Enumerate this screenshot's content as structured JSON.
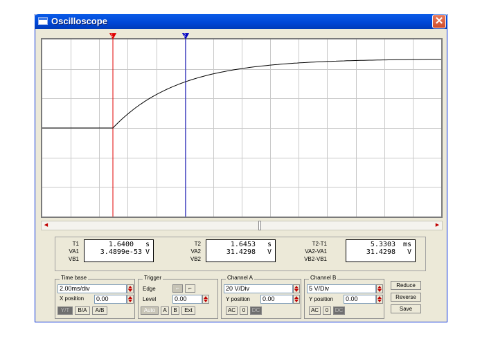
{
  "window": {
    "title": "Oscilloscope",
    "close_glyph": "✕"
  },
  "cursors": [
    {
      "name": "T1",
      "marker_label": "1",
      "color": "#e00000"
    },
    {
      "name": "T2",
      "marker_label": "2",
      "color": "#0000c0"
    }
  ],
  "readouts": {
    "t1": {
      "label_t": "T1",
      "label_va": "VA1",
      "label_vb": "VB1",
      "time_value": "1.6400",
      "time_unit": "s",
      "va_value": "3.4899e-53",
      "va_unit": "V"
    },
    "t2": {
      "label_t": "T2",
      "label_va": "VA2",
      "label_vb": "VB2",
      "time_value": "1.6453",
      "time_unit": "s",
      "va_value": "31.4298",
      "va_unit": "V"
    },
    "diff": {
      "label_t": "T2-T1",
      "label_va": "VA2-VA1",
      "label_vb": "VB2-VB1",
      "time_value": "5.3303",
      "time_unit": "ms",
      "va_value": "31.4298",
      "va_unit": "V"
    }
  },
  "timebase": {
    "title": "Time base",
    "scale": "2.00ms/div",
    "xpos_label": "X position",
    "xpos": "0.00",
    "modes": [
      "Y/T",
      "B/A",
      "A/B"
    ]
  },
  "trigger": {
    "title": "Trigger",
    "edge_label": "Edge",
    "level_label": "Level",
    "level": "0.00",
    "buttons": [
      "Auto",
      "A",
      "B",
      "Ext"
    ]
  },
  "channel_a": {
    "title": "Channel A",
    "scale": "20 V/Div",
    "ypos_label": "Y position",
    "ypos": "0.00",
    "coupling": [
      "AC",
      "0",
      "DC"
    ]
  },
  "channel_b": {
    "title": "Channel B",
    "scale": "5 V/Div",
    "ypos_label": "Y position",
    "ypos": "0.00",
    "coupling": [
      "AC",
      "0",
      "DC"
    ]
  },
  "actions": {
    "reduce": "Reduce",
    "reverse": "Reverse",
    "save": "Save"
  },
  "colors": {
    "trace": "#000000",
    "grid": "#c8c8c8",
    "accent": "#c00000"
  }
}
